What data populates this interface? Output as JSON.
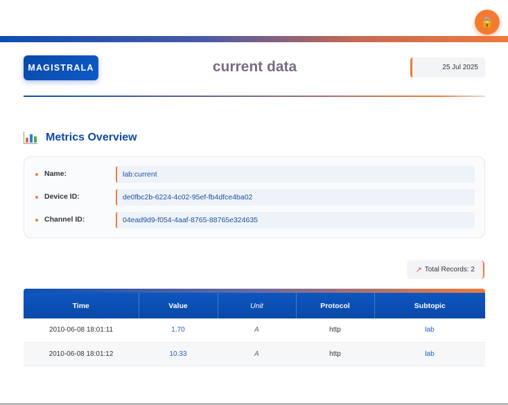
{
  "header": {
    "logo": "MAGISTRALA",
    "title": "current data",
    "date": "25 Jul 2025"
  },
  "lock_icon": "lock-icon",
  "colors": {
    "brand_blue": "#0b4fb3",
    "accent_orange": "#f07a3a"
  },
  "section": {
    "icon": "bar-chart-icon",
    "title": "Metrics Overview"
  },
  "metadata": {
    "rows": [
      {
        "label": "Name:",
        "value": "lab:current"
      },
      {
        "label": "Device ID:",
        "value": "de0fbc2b-6224-4c02-95ef-fb4dfce4ba02"
      },
      {
        "label": "Channel ID:",
        "value": "04ead9d9-f054-4aaf-8765-88765e324635"
      }
    ]
  },
  "records": {
    "icon": "trend-chart-icon",
    "label": "Total Records: 2"
  },
  "table": {
    "headers": [
      "Time",
      "Value",
      "Unit",
      "Protocol",
      "Subtopic"
    ],
    "rows": [
      [
        "2010-06-08 18:01:11",
        "1.70",
        "A",
        "http",
        "lab"
      ],
      [
        "2010-06-08 18:01:12",
        "10.33",
        "A",
        "http",
        "lab"
      ]
    ]
  }
}
